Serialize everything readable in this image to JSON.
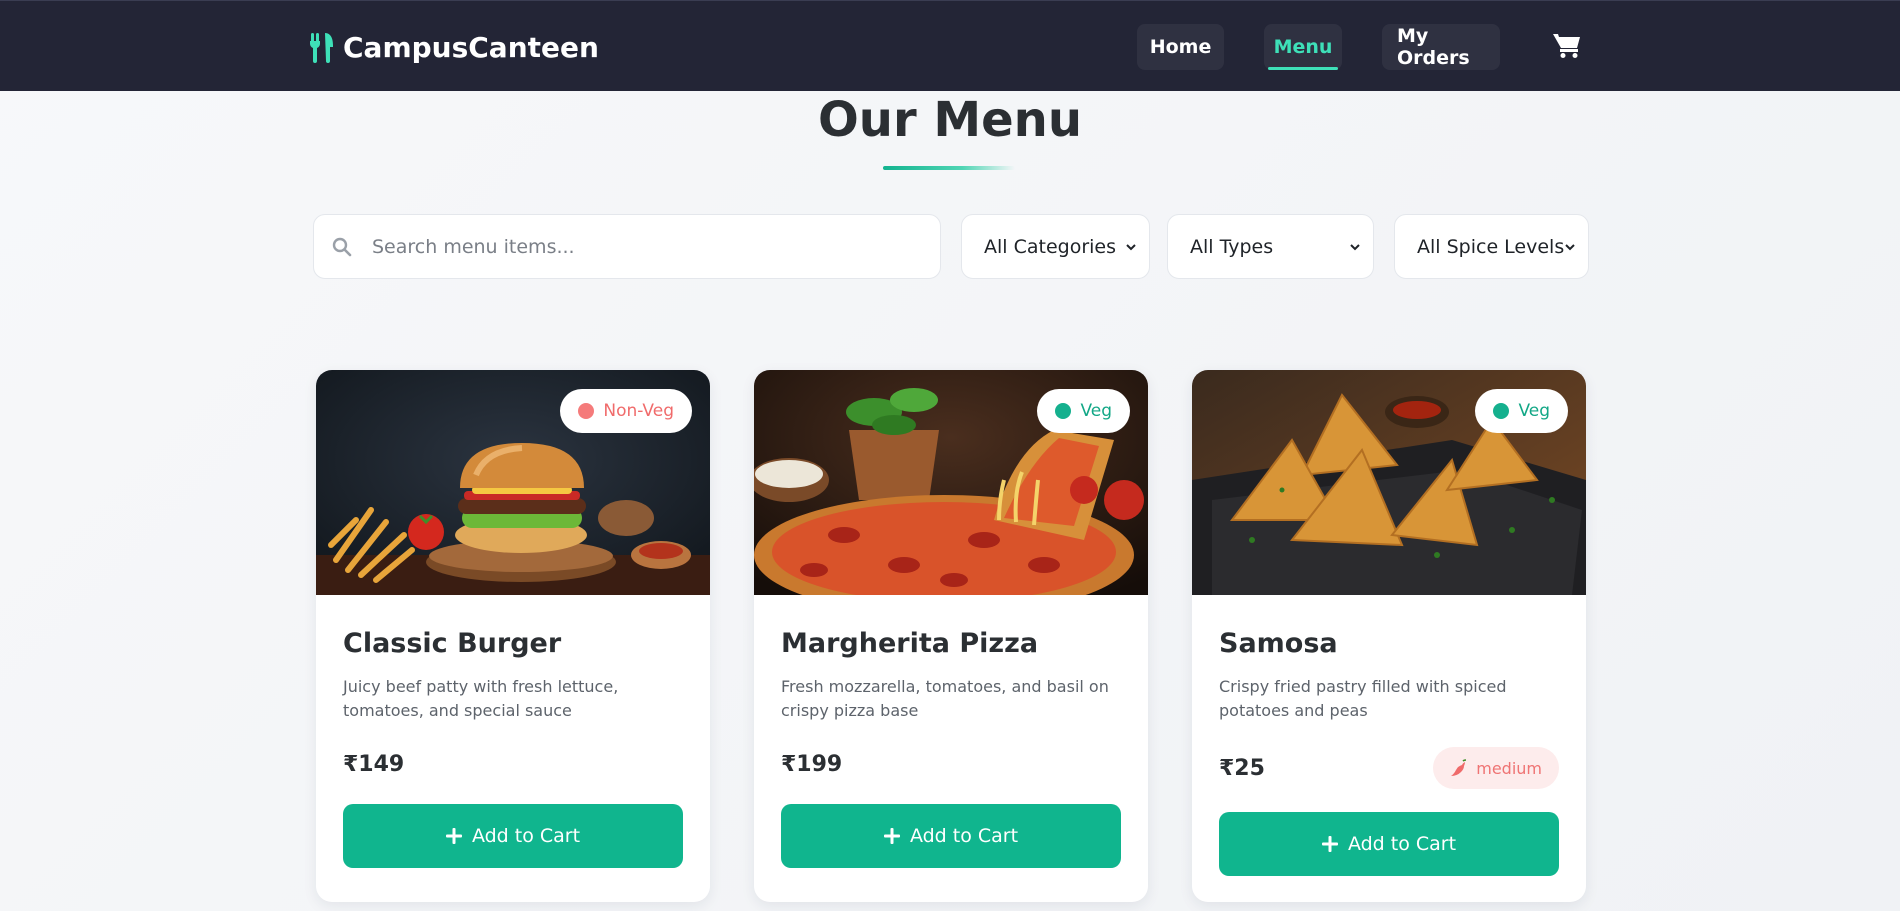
{
  "brand": {
    "name": "CampusCanteen",
    "icon": "fork-icon",
    "accent": "#3ee0b8"
  },
  "nav": {
    "items": [
      {
        "label": "Home"
      },
      {
        "label": "Menu",
        "active": true
      },
      {
        "label": "My Orders"
      }
    ],
    "cart_icon": "shopping-cart-icon"
  },
  "page": {
    "title": "Our Menu"
  },
  "filters": {
    "search_placeholder": "Search menu items...",
    "category": "All Categories",
    "type": "All Types",
    "spice": "All Spice Levels"
  },
  "colors": {
    "primary": "#10b58e",
    "navbar": "#232536",
    "veg": "#15b08e",
    "nonveg": "#f57b7b"
  },
  "items": [
    {
      "name": "Classic Burger",
      "description": "Juicy beef patty with fresh lettuce, tomatoes, and special sauce",
      "price": "₹149",
      "diet": "Non-Veg",
      "button": "Add to Cart"
    },
    {
      "name": "Margherita Pizza",
      "description": "Fresh mozzarella, tomatoes, and basil on crispy pizza base",
      "price": "₹199",
      "diet": "Veg",
      "button": "Add to Cart"
    },
    {
      "name": "Samosa",
      "description": "Crispy fried pastry filled with spiced potatoes and peas",
      "price": "₹25",
      "diet": "Veg",
      "spice": "medium",
      "button": "Add to Cart"
    }
  ]
}
